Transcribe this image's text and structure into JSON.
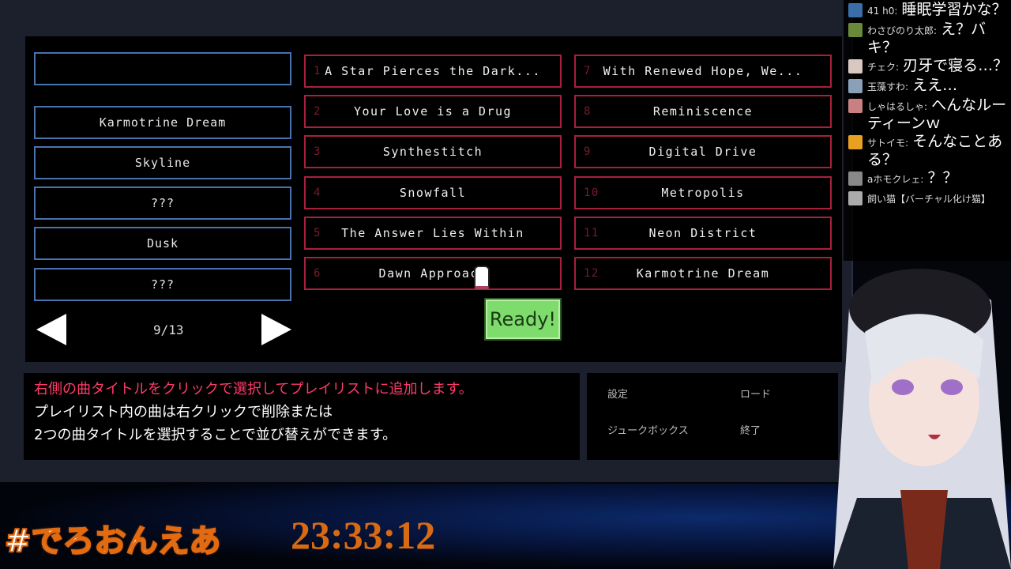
{
  "playlist": {
    "slots": [
      "",
      "Karmotrine Dream",
      "Skyline",
      "???",
      "Dusk",
      "???"
    ],
    "page": "9/13"
  },
  "songs": [
    {
      "num": "1",
      "title": "A Star Pierces the Dark..."
    },
    {
      "num": "2",
      "title": "Your Love is a Drug"
    },
    {
      "num": "3",
      "title": "Synthestitch"
    },
    {
      "num": "4",
      "title": "Snowfall"
    },
    {
      "num": "5",
      "title": "The Answer Lies Within"
    },
    {
      "num": "6",
      "title": "Dawn Approach"
    },
    {
      "num": "7",
      "title": "With Renewed Hope, We..."
    },
    {
      "num": "8",
      "title": "Reminiscence"
    },
    {
      "num": "9",
      "title": "Digital Drive"
    },
    {
      "num": "10",
      "title": "Metropolis"
    },
    {
      "num": "11",
      "title": "Neon District"
    },
    {
      "num": "12",
      "title": "Karmotrine Dream"
    }
  ],
  "ready_label": "Ready!",
  "message": {
    "line1": "右側の曲タイトルをクリックで選択してプレイリストに追加します。",
    "line2": "プレイリスト内の曲は右クリックで削除または",
    "line3": "2つの曲タイトルを選択することで並び替えができます。",
    "highlight_color": "#ff3a6a"
  },
  "menu": {
    "settings": "設定",
    "load": "ロード",
    "jukebox": "ジュークボックス",
    "quit": "終了"
  },
  "overlay": {
    "hashtag": "#でろおんえあ",
    "clock": "23:33:12"
  },
  "chat": [
    {
      "name": "41 h0:",
      "text": "睡眠学習かな？"
    },
    {
      "name": "わさびのり太郎:",
      "text": "え？バキ？"
    },
    {
      "name": "チェク:",
      "text": "刃牙で寝る…？"
    },
    {
      "name": "玉藻すわ:",
      "text": "ええ…"
    },
    {
      "name": "しゃはるしゃ:",
      "text": "へんなルーティーンｗ"
    },
    {
      "name": "サトイモ:",
      "text": "そんなことある？"
    },
    {
      "name": "aホモクレェ:",
      "text": "？？"
    },
    {
      "name": "飼い猫【バーチャル化け猫】",
      "text": ""
    }
  ]
}
